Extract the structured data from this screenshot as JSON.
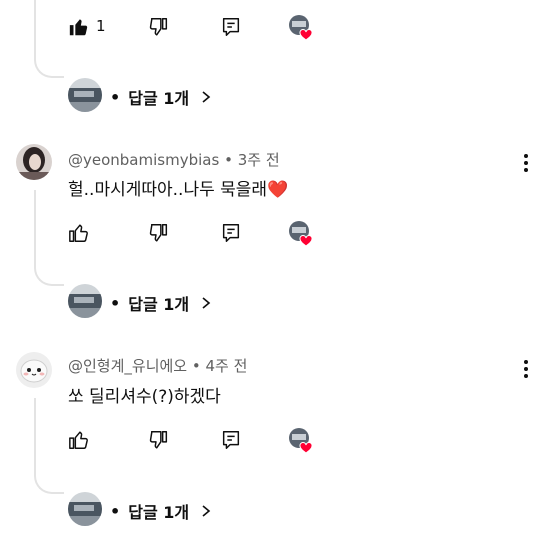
{
  "icons": {
    "like": "thumbs-up-icon",
    "dislike": "thumbs-down-icon",
    "reply": "reply-icon",
    "heart": "creator-heart-icon",
    "more": "more-vertical-icon",
    "chevron": "chevron-right-icon"
  },
  "colors": {
    "heart": "#ff0033",
    "line": "#e3e3e3",
    "secondary": "#606060"
  },
  "top_actions": {
    "like_count": "1"
  },
  "reply_rows": [
    {
      "dot": "•",
      "label": "답글 1개"
    },
    {
      "dot": "•",
      "label": "답글 1개"
    },
    {
      "dot": "•",
      "label": "답글 1개"
    }
  ],
  "comments": [
    {
      "handle": "@yeonbamismybias",
      "time": "3주 전",
      "text": "헐..마시게따아..나두 묵을래",
      "emoji": "❤️"
    },
    {
      "handle": "@인형계_유니에오",
      "time": "4주 전",
      "text": "쏘 딜리셔수(?)하겠다"
    }
  ]
}
